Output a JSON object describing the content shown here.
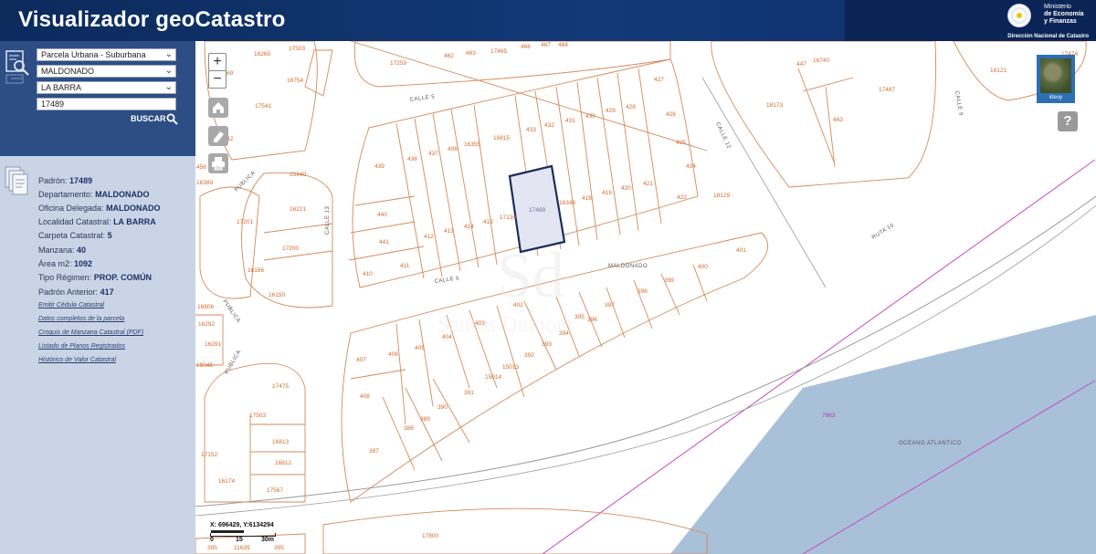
{
  "header": {
    "title": "Visualizador geoCatastro",
    "ministry_line1": "Ministerio",
    "ministry_line2": "de Economía",
    "ministry_line3": "y Finanzas",
    "department": "Dirección Nacional de Catastro"
  },
  "search": {
    "parcel_type": "Parcela Urbana - Suburbana",
    "department": "MALDONADO",
    "locality": "LA BARRA",
    "padron": "17489",
    "buscar_label": "BUSCAR"
  },
  "info": {
    "rows": [
      {
        "label": "Padrón:",
        "value": "17489"
      },
      {
        "label": "Departamento:",
        "value": "MALDONADO"
      },
      {
        "label": "Oficina Delegada:",
        "value": "MALDONADO"
      },
      {
        "label": "Localidad Catastral:",
        "value": "LA BARRA"
      },
      {
        "label": "Carpeta Catastral:",
        "value": "5"
      },
      {
        "label": "Manzana:",
        "value": "40"
      },
      {
        "label": "Área m2:",
        "value": "1092"
      },
      {
        "label": "Tipo Régimen:",
        "value": "PROP. COMÚN"
      },
      {
        "label": "Padrón Anterior:",
        "value": "417"
      }
    ],
    "links": [
      "Emitir Cédula Catastral",
      "Datos completos de la parcela",
      "Croquis de Manzana Catastral (PDF)",
      "Listado de Planos Registrados",
      "Histórico de Valor Catastral"
    ]
  },
  "map": {
    "zoom_in": "+",
    "zoom_out": "−",
    "ideuy_label": "ideuy",
    "help_label": "?",
    "coords": "X: 696429, Y:6134294",
    "scale_labels": [
      "0",
      "15",
      "30m"
    ],
    "streets": [
      "CALLE 5",
      "CALLE 12",
      "CALLE 6",
      "CALLE 13",
      "MALDONADO",
      "RUTA 10",
      "CALLE 9",
      "PUBLICA",
      "PUBLICA",
      "PUBLICA",
      "OCEANO ATLANTICO"
    ],
    "parcels": [
      "17503",
      "16265",
      "17259",
      "462",
      "463",
      "17465",
      "466",
      "467",
      "468",
      "16754",
      "17541",
      "427",
      "426",
      "425",
      "424",
      "422",
      "18129",
      "433",
      "432",
      "431",
      "430",
      "429",
      "428",
      "439",
      "438",
      "437",
      "436",
      "16355",
      "16815",
      "440",
      "441",
      "410",
      "411",
      "412",
      "413",
      "414",
      "415",
      "17130",
      "17489",
      "16346",
      "418",
      "419",
      "420",
      "421",
      "15940",
      "16221",
      "17201",
      "17200",
      "16166",
      "16150",
      "18173",
      "447",
      "16740",
      "17487",
      "443",
      "16121",
      "17474",
      "401",
      "400",
      "399",
      "398",
      "397",
      "396",
      "395",
      "394",
      "393",
      "392",
      "402",
      "403",
      "404",
      "405",
      "406",
      "407",
      "408",
      "389",
      "388",
      "387",
      "390",
      "391",
      "15014",
      "15013",
      "17475",
      "17503",
      "16813",
      "16812",
      "17152",
      "16174",
      "17567",
      "17800",
      "7963",
      "16292",
      "16291",
      "16806",
      "16389",
      "15045",
      "42",
      "69",
      "456",
      "395",
      "11639",
      "395"
    ],
    "colors": {
      "parcel_line": "#d4895a",
      "selected_outline": "#1b2d5c",
      "ocean": "#a9c0d9",
      "boundary": "#c44bc4"
    }
  }
}
